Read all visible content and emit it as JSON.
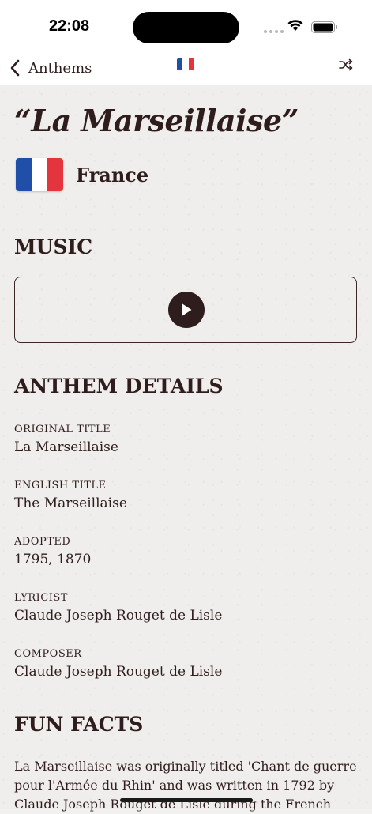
{
  "status_bar": {
    "time": "22:08"
  },
  "nav": {
    "back_label": "Anthems",
    "back_icon": "chevron-left-icon",
    "shuffle_icon": "shuffle-icon",
    "flag_colors": [
      "#1f4fa8",
      "#ffffff",
      "#e4343d"
    ]
  },
  "anthem": {
    "title": "“La Marseillaise”",
    "country": "France",
    "flag_colors": [
      "#1f4fa8",
      "#ffffff",
      "#e4343d"
    ]
  },
  "music": {
    "heading": "MUSIC",
    "play_icon": "play-icon"
  },
  "details": {
    "heading": "ANTHEM DETAILS",
    "original_title": {
      "label": "ORIGINAL TITLE",
      "value": "La Marseillaise"
    },
    "english_title": {
      "label": "ENGLISH TITLE",
      "value": "The Marseillaise"
    },
    "adopted": {
      "label": "ADOPTED",
      "value": "1795, 1870"
    },
    "lyricist": {
      "label": "LYRICIST",
      "value": "Claude Joseph Rouget de Lisle"
    },
    "composer": {
      "label": "COMPOSER",
      "value": "Claude Joseph Rouget de Lisle"
    }
  },
  "fun_facts": {
    "heading": "FUN FACTS",
    "text": "La Marseillaise was originally titled 'Chant de guerre pour l'Armée du Rhin' and was written in 1792 by Claude Joseph Rouget de Lisle during the French"
  },
  "colors": {
    "text": "#2e1d1c",
    "background": "#efeeec"
  }
}
